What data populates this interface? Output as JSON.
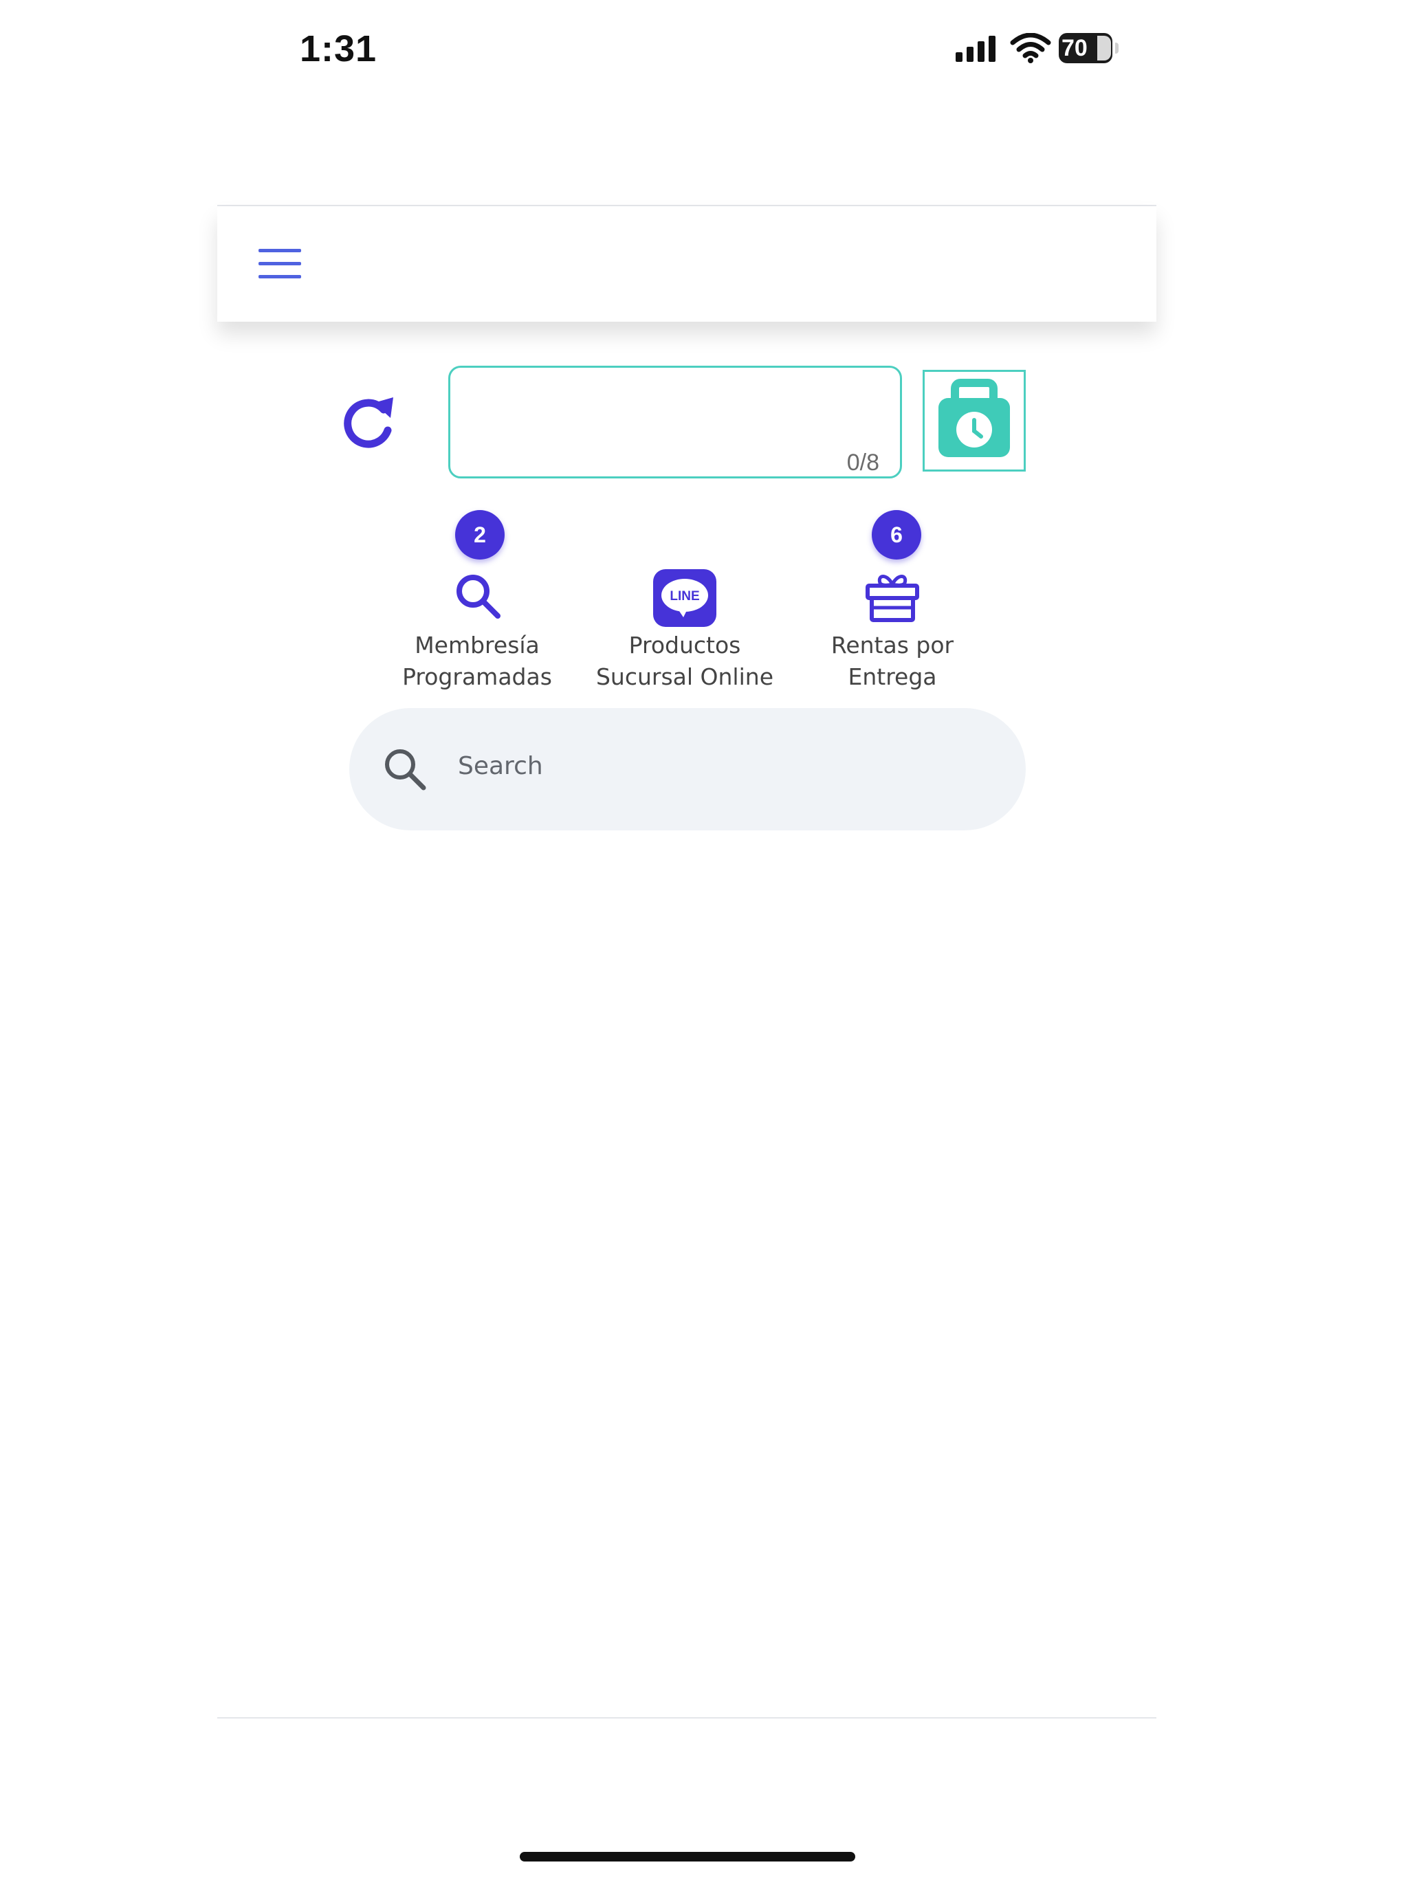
{
  "status_bar": {
    "time": "1:31",
    "battery": "70"
  },
  "code_field": {
    "counter": "0/8"
  },
  "shortcuts": [
    {
      "line1": "Membresía",
      "line2": "Programadas",
      "badge": "2",
      "icon": "search-icon"
    },
    {
      "line1": "Productos",
      "line2": "Sucursal Online",
      "icon": "line-app-icon",
      "logo_text": "LINE"
    },
    {
      "line1": "Rentas por",
      "line2": "Entrega",
      "badge": "6",
      "icon": "gift-box-icon"
    }
  ],
  "search": {
    "placeholder": "Search"
  },
  "colors": {
    "primary": "#4633d8",
    "accent": "#4ccfc0",
    "search_bg": "#f0f3f7"
  }
}
